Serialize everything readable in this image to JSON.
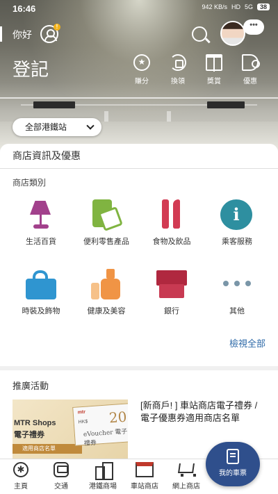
{
  "status_bar": {
    "time": "16:46",
    "speed": "942 KB/s",
    "network": "HD",
    "signal": "5G",
    "battery": "38"
  },
  "header": {
    "greeting": "你好",
    "user_badge": "!",
    "chat_bubble": "•••",
    "title": "登記",
    "quick_actions": [
      {
        "label": "賺分",
        "icon": "star-circle-icon"
      },
      {
        "label": "換領",
        "icon": "redeem-cycle-icon"
      },
      {
        "label": "獎賞",
        "icon": "gift-icon"
      },
      {
        "label": "優惠",
        "icon": "megaphone-icon"
      }
    ],
    "station_filter": "全部港鐵站"
  },
  "shops": {
    "section_title": "商店資訊及優惠",
    "category_heading": "商店類別",
    "categories": [
      {
        "label": "生活百貨",
        "icon": "lamp-icon",
        "color": "#a2418c"
      },
      {
        "label": "便利零售產品",
        "icon": "convenience-icon",
        "color": "#80b441"
      },
      {
        "label": "食物及飲品",
        "icon": "fork-knife-icon",
        "color": "#d23b53"
      },
      {
        "label": "乘客服務",
        "icon": "info-icon",
        "color": "#2e8fa0"
      },
      {
        "label": "時裝及飾物",
        "icon": "handbag-icon",
        "color": "#2f95d0"
      },
      {
        "label": "健康及美容",
        "icon": "cosmetics-icon",
        "color": "#f09445"
      },
      {
        "label": "銀行",
        "icon": "banknote-icon",
        "color": "#b0283f"
      },
      {
        "label": "其他",
        "icon": "more-icon",
        "color": "#7a96a8"
      }
    ],
    "view_all": "檢視全部"
  },
  "promotions": {
    "heading": "推廣活動",
    "item": {
      "image_line1": "MTR Shops",
      "image_line2": "電子禮券",
      "image_strip": "適用商店名單",
      "voucher_brand": "mtr",
      "voucher_currency": "HK$",
      "voucher_amount": "20",
      "voucher_text": "eVoucher 電子禮券",
      "text": "[新商戶! ] 車站商店電子禮券 / 電子優惠券適用商店名單"
    }
  },
  "bottom_nav": {
    "items": [
      {
        "label": "主頁"
      },
      {
        "label": "交通"
      },
      {
        "label": "港鐵商場"
      },
      {
        "label": "車站商店"
      },
      {
        "label": "網上商店"
      }
    ],
    "fab_label": "我的車票"
  }
}
